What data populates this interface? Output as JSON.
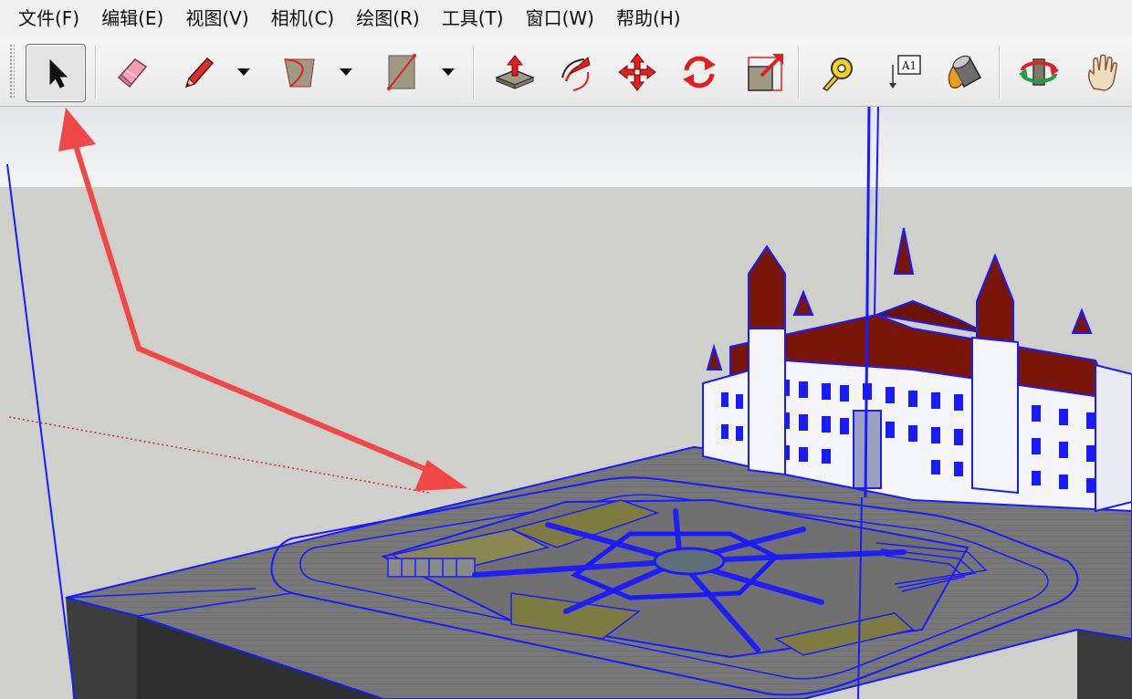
{
  "menu": {
    "items": [
      {
        "label": "文件(F)"
      },
      {
        "label": "编辑(E)"
      },
      {
        "label": "视图(V)"
      },
      {
        "label": "相机(C)"
      },
      {
        "label": "绘图(R)"
      },
      {
        "label": "工具(T)"
      },
      {
        "label": "窗口(W)"
      },
      {
        "label": "帮助(H)"
      }
    ]
  },
  "toolbar": {
    "tools": [
      {
        "name": "select-tool",
        "icon": "arrow-cursor-icon",
        "active": true
      },
      {
        "name": "eraser-tool",
        "icon": "eraser-icon"
      },
      {
        "name": "line-tool",
        "icon": "pencil-icon"
      },
      {
        "name": "arc-tool",
        "icon": "arc-icon"
      },
      {
        "name": "rectangle-tool",
        "icon": "rectangle-icon"
      },
      {
        "name": "push-pull-tool",
        "icon": "push-pull-icon"
      },
      {
        "name": "offset-tool",
        "icon": "offset-icon"
      },
      {
        "name": "move-tool",
        "icon": "move-icon"
      },
      {
        "name": "rotate-tool",
        "icon": "rotate-icon"
      },
      {
        "name": "scale-tool",
        "icon": "scale-icon"
      },
      {
        "name": "tape-measure-tool",
        "icon": "tape-measure-icon"
      },
      {
        "name": "text-tool",
        "icon": "text-label-icon",
        "label": "A1"
      },
      {
        "name": "paint-bucket-tool",
        "icon": "paint-bucket-icon"
      },
      {
        "name": "orbit-tool",
        "icon": "orbit-icon"
      },
      {
        "name": "pan-tool",
        "icon": "hand-icon"
      }
    ]
  },
  "colors": {
    "selection_blue": "#1a1aff",
    "annotation_red": "#f04848",
    "roof_red": "#7a1608",
    "ground_gray": "#767676",
    "sky_gradient_top": "#e9ebee",
    "background_gray": "#cfcfcb",
    "lawn_olive": "#7d7a42"
  }
}
